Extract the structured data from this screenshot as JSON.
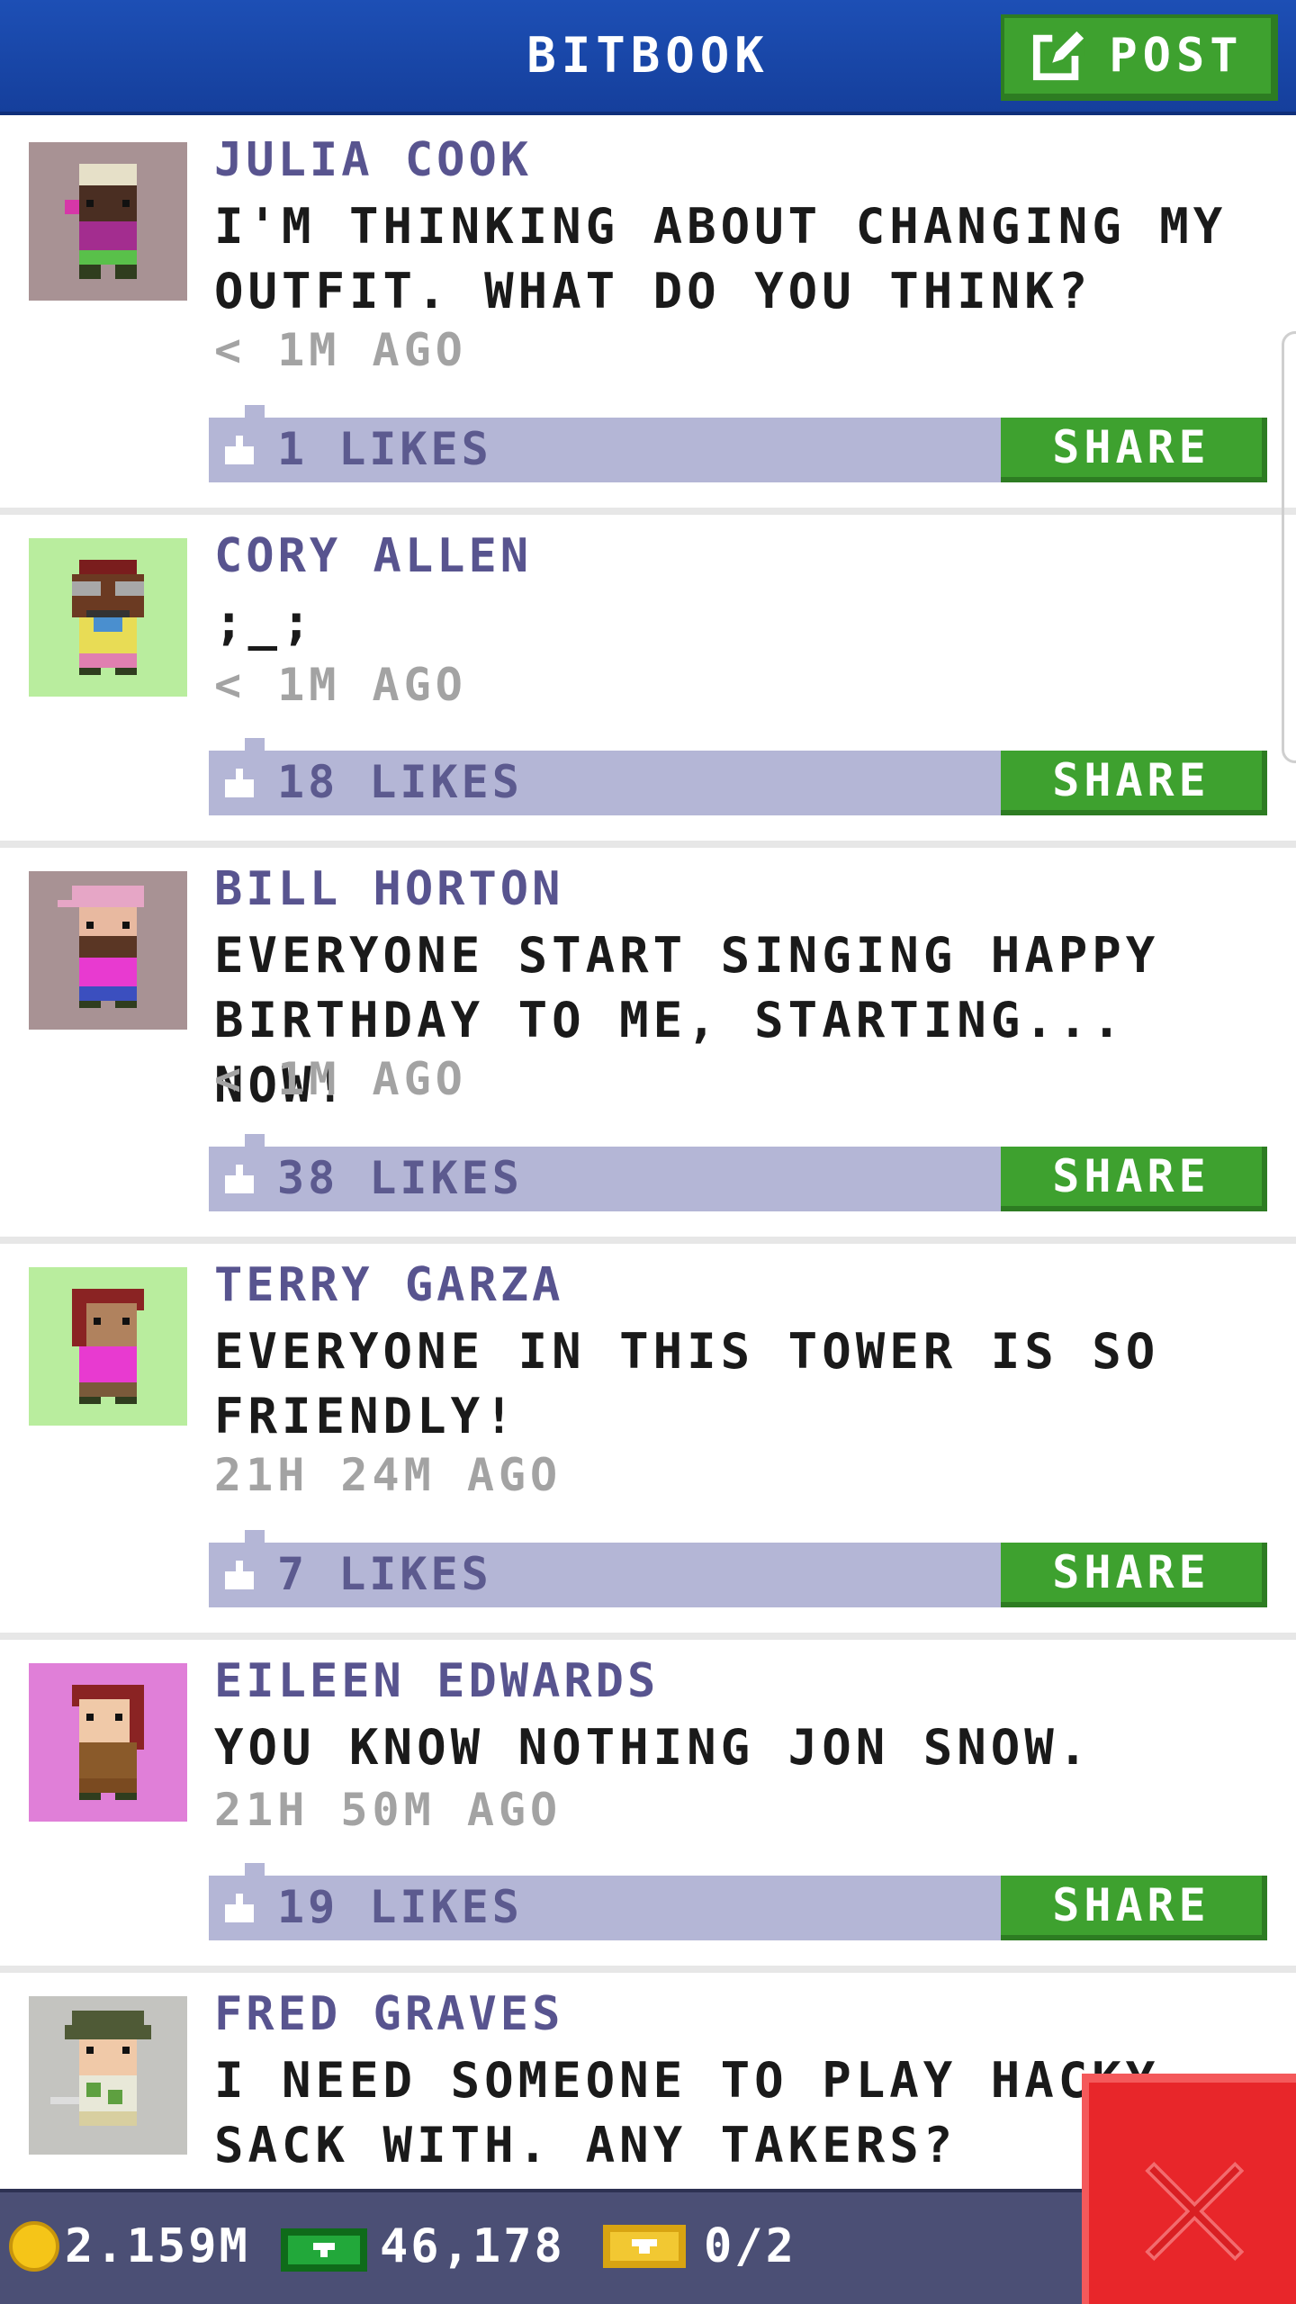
{
  "header": {
    "title": "BITBOOK",
    "post_label": "POST"
  },
  "posts": [
    {
      "author": "JULIA COOK",
      "message": "I'M THINKING ABOUT CHANGING MY OUTFIT. WHAT DO YOU THINK?",
      "time": "< 1M AGO",
      "likes": "1 LIKES",
      "share_label": "SHARE",
      "avatar_bg": "#a89294"
    },
    {
      "author": "CORY ALLEN",
      "message": ";_;",
      "time": "< 1M AGO",
      "likes": "18 LIKES",
      "share_label": "SHARE",
      "avatar_bg": "#b9ed9e"
    },
    {
      "author": "BILL HORTON",
      "message": "EVERYONE START SINGING HAPPY BIRTHDAY TO ME, STARTING... NOW!",
      "time": "< 1M AGO",
      "likes": "38 LIKES",
      "share_label": "SHARE",
      "avatar_bg": "#a89294"
    },
    {
      "author": "TERRY GARZA",
      "message": "EVERYONE IN THIS TOWER IS SO FRIENDLY!",
      "time": "21H 24M AGO",
      "likes": "7 LIKES",
      "share_label": "SHARE",
      "avatar_bg": "#b9ed9e"
    },
    {
      "author": "EILEEN EDWARDS",
      "message": "YOU KNOW NOTHING JON SNOW.",
      "time": "21H 50M AGO",
      "likes": "19 LIKES",
      "share_label": "SHARE",
      "avatar_bg": "#e07fd8"
    },
    {
      "author": "FRED GRAVES",
      "message": "I NEED SOMEONE TO PLAY HACKY SACK WITH. ANY TAKERS?",
      "time": "",
      "likes": "",
      "share_label": "",
      "avatar_bg": "#c4c4c0"
    }
  ],
  "status": {
    "coins": "2.159M",
    "bux": "46,178",
    "tickets": "0/2"
  },
  "colors": {
    "header": "#1d4fb5",
    "green": "#3ea12f",
    "likes_bar": "#b4b6d6",
    "author": "#58548f",
    "close": "#e8262a"
  }
}
